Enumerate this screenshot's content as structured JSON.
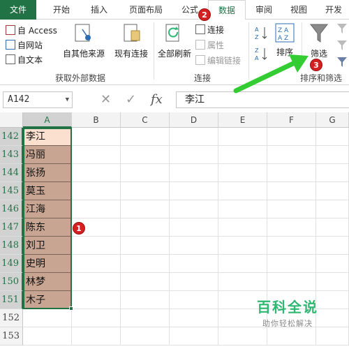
{
  "tabs": [
    {
      "label": "文件"
    },
    {
      "label": "开始"
    },
    {
      "label": "插入"
    },
    {
      "label": "页面布局"
    },
    {
      "label": "公式"
    },
    {
      "label": "数据"
    },
    {
      "label": "审阅"
    },
    {
      "label": "视图"
    },
    {
      "label": "开发"
    }
  ],
  "ribbon": {
    "get_external": {
      "access": "自 Access",
      "web": "自网站",
      "text": "自文本",
      "other_sources": "自其他来源",
      "existing_connections": "现有连接",
      "group_label": "获取外部数据"
    },
    "connections": {
      "refresh_all": "全部刷新",
      "connections": "连接",
      "properties": "属性",
      "edit_links": "编辑链接",
      "group_label": "连接"
    },
    "sort_filter": {
      "sort": "排序",
      "filter": "筛选",
      "group_label": "排序和筛选"
    }
  },
  "formula_bar": {
    "name_box": "A142",
    "fx": "fx",
    "value": "李江"
  },
  "grid": {
    "columns": [
      "A",
      "B",
      "C",
      "D",
      "E",
      "F",
      "G"
    ],
    "rows": [
      {
        "num": "142",
        "a": "李江"
      },
      {
        "num": "143",
        "a": "冯丽"
      },
      {
        "num": "144",
        "a": "张扬"
      },
      {
        "num": "145",
        "a": "莫玉"
      },
      {
        "num": "146",
        "a": "江海"
      },
      {
        "num": "147",
        "a": "陈东"
      },
      {
        "num": "148",
        "a": "刘卫"
      },
      {
        "num": "149",
        "a": "史明"
      },
      {
        "num": "150",
        "a": "林梦"
      },
      {
        "num": "151",
        "a": "木子"
      },
      {
        "num": "152",
        "a": ""
      },
      {
        "num": "153",
        "a": ""
      }
    ]
  },
  "callouts": [
    "1",
    "2",
    "3"
  ],
  "watermark": {
    "title": "百科全说",
    "subtitle": "助你轻松解决"
  },
  "colors": {
    "accent": "#217346",
    "selection_fill": "#c8a592",
    "callout": "#d42020",
    "arrow": "#33cc33"
  }
}
